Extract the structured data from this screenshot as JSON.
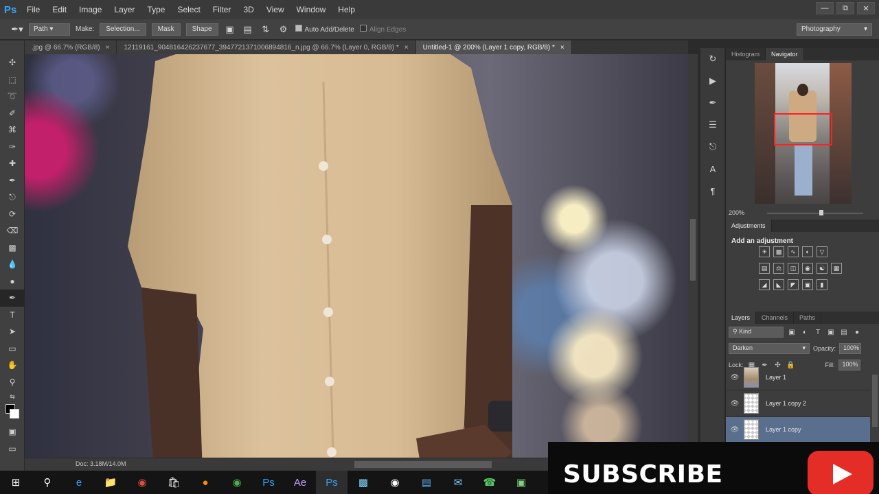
{
  "menu": {
    "logo": "Ps",
    "items": [
      "File",
      "Edit",
      "Image",
      "Layer",
      "Type",
      "Select",
      "Filter",
      "3D",
      "View",
      "Window",
      "Help"
    ]
  },
  "options": {
    "tool_mode": "Path",
    "make_label": "Make:",
    "selection_btn": "Selection...",
    "mask_btn": "Mask",
    "shape_btn": "Shape",
    "auto_add_delete": "Auto Add/Delete",
    "align_edges": "Align Edges",
    "workspace": "Photography"
  },
  "tabs": [
    ".jpg @ 66.7% (RGB/8)",
    "12119161_904816426237677_3947721371006894816_n.jpg @ 66.7% (Layer 0, RGB/8) *",
    "Untitled-1 @ 200% (Layer 1 copy, RGB/8) *"
  ],
  "status": {
    "doc": "Doc: 3.18M/14.0M"
  },
  "panels": {
    "top_tabs": [
      "Histogram",
      "Navigator"
    ],
    "zoom": "200%",
    "adjustments_tab": "Adjustments",
    "adjustments_title": "Add an adjustment",
    "layers_tabs": [
      "Layers",
      "Channels",
      "Paths"
    ],
    "kind_filter": "Kind",
    "blend_mode": "Darken",
    "opacity_label": "Opacity:",
    "opacity": "100%",
    "lock_label": "Lock:",
    "fill_label": "Fill:",
    "fill": "100%",
    "layers": [
      {
        "name": "Layer 1",
        "selected": false
      },
      {
        "name": "Layer 1 copy 2",
        "selected": false
      },
      {
        "name": "Layer 1 copy",
        "selected": true
      }
    ]
  },
  "banner": {
    "text": "SUBSCRIBE"
  },
  "colors": {
    "accent": "#33a7ff",
    "selected_layer": "#5a6f8d",
    "youtube_red": "#e52d27"
  }
}
